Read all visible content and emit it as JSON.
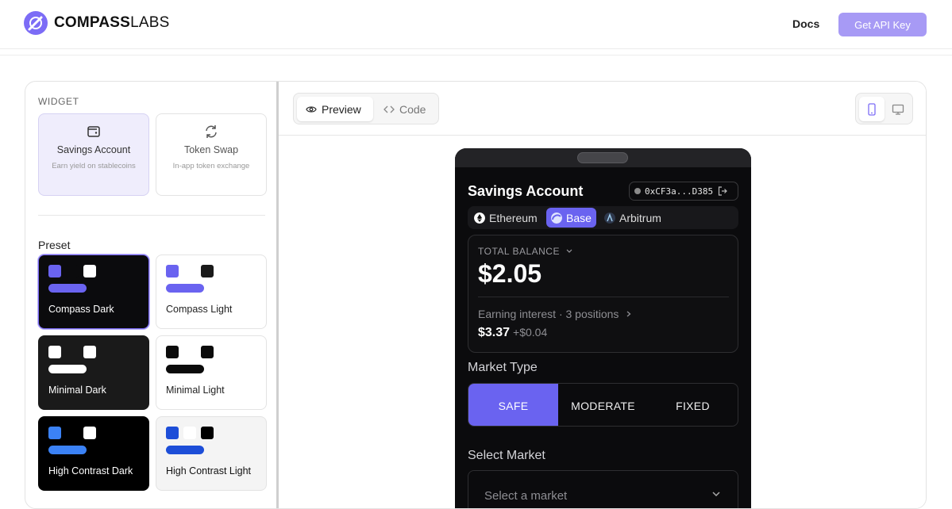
{
  "nav": {
    "brand_bold": "COMPASS",
    "brand_light": "LABS",
    "docs": "Docs",
    "cta": "Get API Key"
  },
  "sidebar": {
    "widget_label": "WIDGET",
    "widgets": [
      {
        "title": "Savings Account",
        "desc": "Earn yield on stablecoins",
        "icon": "wallet-icon",
        "active": true
      },
      {
        "title": "Token Swap",
        "desc": "In-app token exchange",
        "icon": "refresh-icon",
        "active": false
      }
    ],
    "preset_label": "Preset",
    "presets": [
      {
        "name": "Compass Dark",
        "colors": [
          "#6a63f0",
          "#0b0b0d",
          "#ffffff"
        ],
        "bar": "#6a63f0",
        "bg": "#0b0b0d",
        "text": "#ffffff",
        "selected": true
      },
      {
        "name": "Compass Light",
        "colors": [
          "#6a63f0",
          "#ffffff",
          "#1a1a1a"
        ],
        "bar": "#6a63f0",
        "bg": "#ffffff",
        "text": "#222222",
        "selected": false
      },
      {
        "name": "Minimal Dark",
        "colors": [
          "#ffffff",
          "#1a1a1a",
          "#ffffff"
        ],
        "bar": "#ffffff",
        "bg": "#1a1a1a",
        "text": "#ffffff",
        "selected": false
      },
      {
        "name": "Minimal Light",
        "colors": [
          "#0b0b0b",
          "#ffffff",
          "#0b0b0b"
        ],
        "bar": "#0b0b0b",
        "bg": "#ffffff",
        "text": "#222222",
        "selected": false
      },
      {
        "name": "High Contrast Dark",
        "colors": [
          "#3b82f6",
          "#000000",
          "#ffffff"
        ],
        "bar": "#3b82f6",
        "bg": "#000000",
        "text": "#ffffff",
        "selected": false
      },
      {
        "name": "High Contrast Light",
        "colors": [
          "#1d4ed8",
          "#ffffff",
          "#000000"
        ],
        "bar": "#1d4ed8",
        "bg": "#f4f4f4",
        "text": "#111111",
        "selected": false
      }
    ]
  },
  "preview": {
    "tabs": [
      {
        "label": "Preview",
        "icon": "eye-icon",
        "active": true
      },
      {
        "label": "Code",
        "icon": "code-icon",
        "active": false
      }
    ],
    "devices": [
      "mobile-icon",
      "desktop-icon"
    ]
  },
  "widget": {
    "title": "Savings Account",
    "wallet": "0xCF3a...D385",
    "chains": [
      {
        "label": "Ethereum",
        "icon": "ethereum-icon",
        "active": false
      },
      {
        "label": "Base",
        "icon": "base-icon",
        "active": true
      },
      {
        "label": "Arbitrum",
        "icon": "arbitrum-icon",
        "active": false
      }
    ],
    "balance_label": "TOTAL BALANCE",
    "balance_value": "$2.05",
    "earning_label": "Earning interest · 3 positions",
    "earning_value": "$3.37",
    "earning_delta": "+$0.04",
    "market_type_label": "Market Type",
    "market_types": [
      "SAFE",
      "MODERATE",
      "FIXED"
    ],
    "market_type_selected": "SAFE",
    "select_market_label": "Select Market",
    "select_market_placeholder": "Select a market"
  },
  "colors": {
    "accent": "#6a63f0",
    "cta": "#a79af5"
  }
}
